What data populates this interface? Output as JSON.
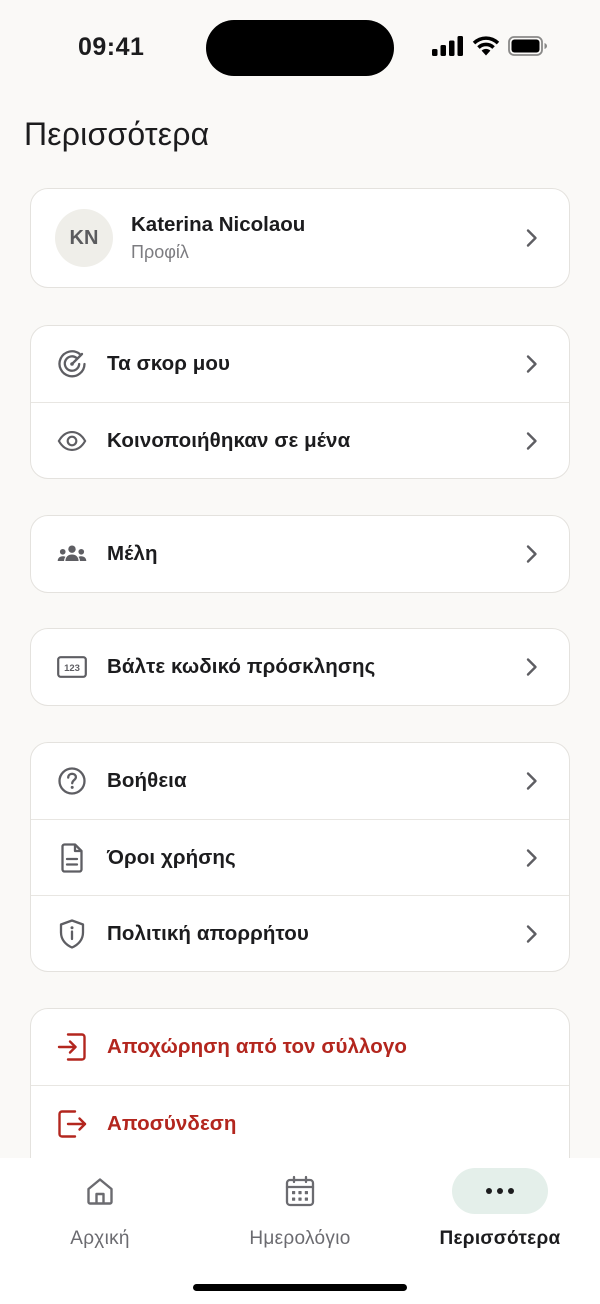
{
  "status_bar": {
    "time": "09:41"
  },
  "header": {
    "title": "Περισσότερα"
  },
  "profile": {
    "initials": "KN",
    "name": "Katerina Nicolaou",
    "subtitle": "Προφίλ"
  },
  "groups": {
    "scores": [
      {
        "label": "Τα σκορ μου",
        "icon": "target-icon"
      },
      {
        "label": "Κοινοποιήθηκαν σε μένα",
        "icon": "eye-icon"
      }
    ],
    "members": [
      {
        "label": "Μέλη",
        "icon": "group-icon"
      }
    ],
    "invite": [
      {
        "label": "Βάλτε κωδικό πρόσκλησης",
        "icon": "code-123-icon"
      }
    ],
    "support": [
      {
        "label": "Βοήθεια",
        "icon": "help-circle-icon"
      },
      {
        "label": "Όροι χρήσης",
        "icon": "document-icon"
      },
      {
        "label": "Πολιτική απορρήτου",
        "icon": "shield-icon"
      }
    ],
    "account": [
      {
        "label": "Αποχώρηση από τον σύλλογο",
        "icon": "leave-icon"
      },
      {
        "label": "Αποσύνδεση",
        "icon": "logout-icon"
      }
    ]
  },
  "tabbar": {
    "tabs": [
      {
        "label": "Αρχική",
        "icon": "home-icon"
      },
      {
        "label": "Ημερολόγιο",
        "icon": "calendar-icon"
      },
      {
        "label": "Περισσότερα",
        "icon": "more-icon"
      }
    ],
    "active_index": 2
  },
  "colors": {
    "accent_danger": "#B3261E",
    "active_tab_bg": "#E4EFEA",
    "background": "#FAF9F7"
  }
}
